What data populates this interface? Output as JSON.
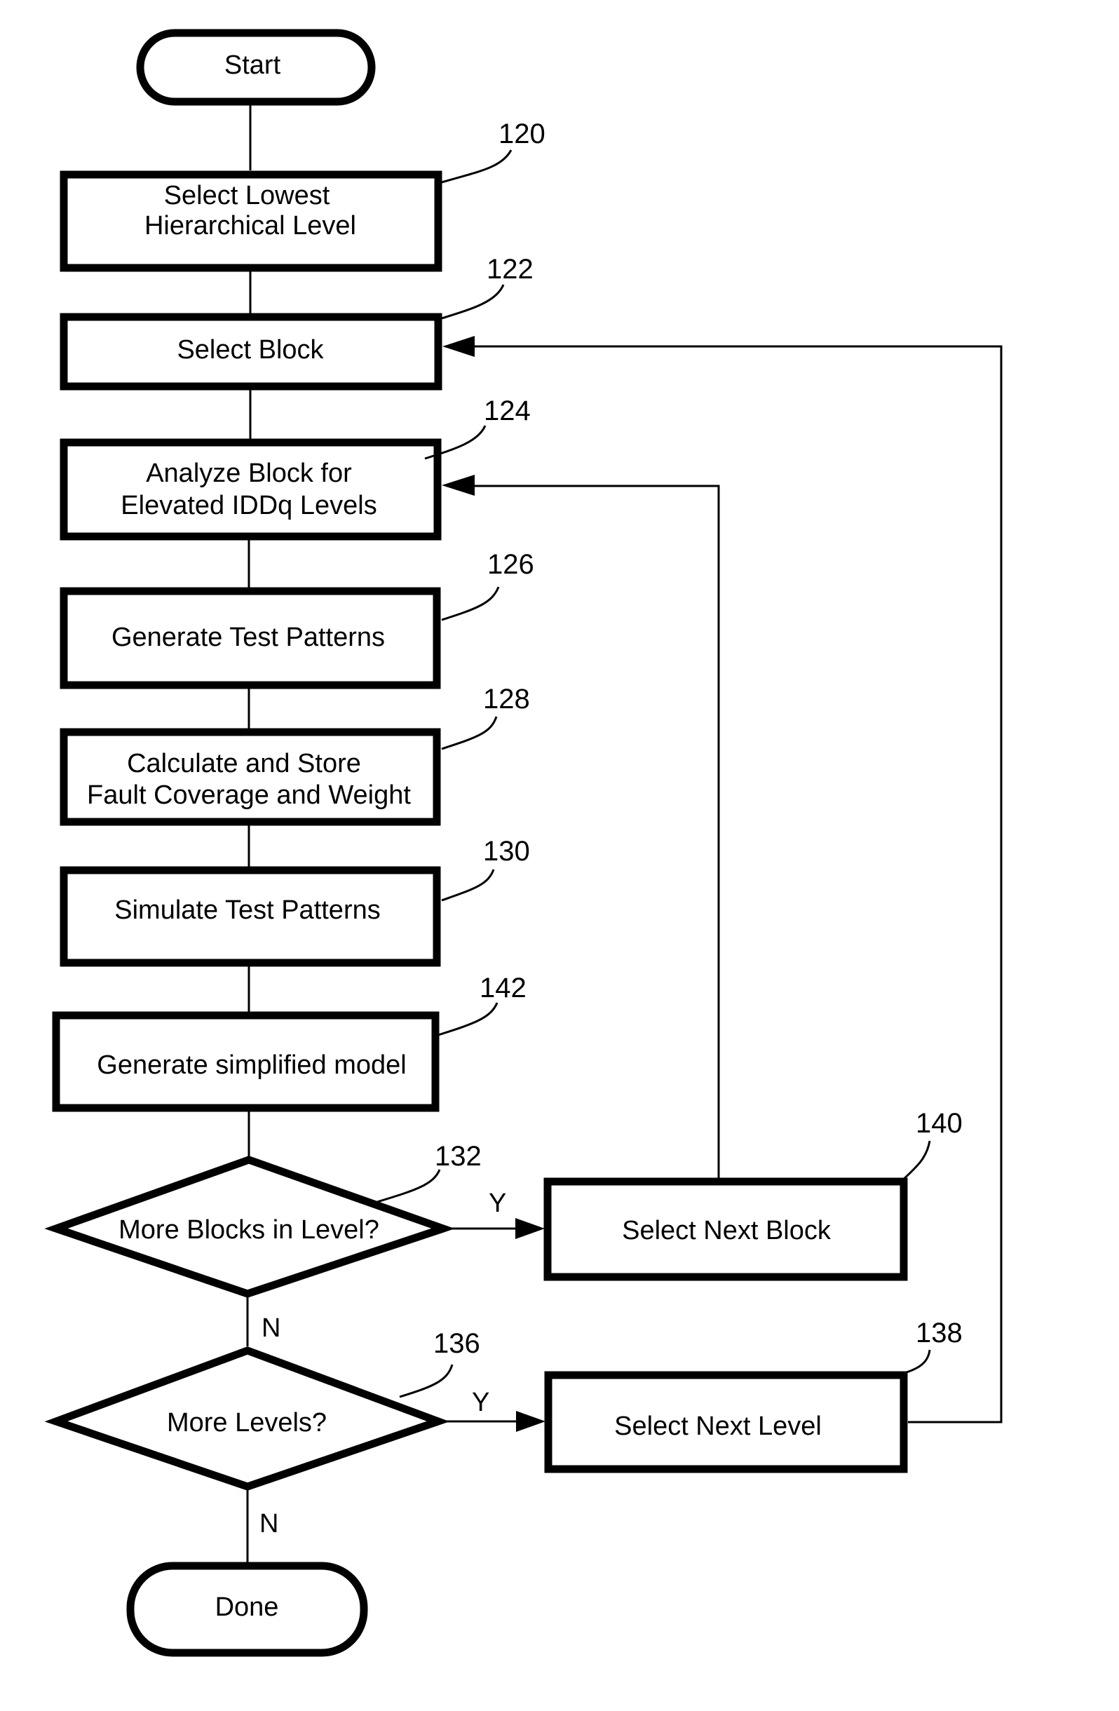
{
  "figure": {
    "kind": "flowchart",
    "colors": {
      "stroke": "#000000",
      "background": "#ffffff"
    }
  },
  "nodes": {
    "start": {
      "shape": "terminator",
      "lines": [
        "Start"
      ]
    },
    "n120": {
      "shape": "process",
      "ref": "120",
      "lines": [
        "Select Lowest",
        "Hierarchical Level"
      ]
    },
    "n122": {
      "shape": "process",
      "ref": "122",
      "lines": [
        "Select Block"
      ]
    },
    "n124": {
      "shape": "process",
      "ref": "124",
      "lines": [
        "Analyze Block for",
        "Elevated IDDq Levels"
      ]
    },
    "n126": {
      "shape": "process",
      "ref": "126",
      "lines": [
        "Generate Test Patterns"
      ]
    },
    "n128": {
      "shape": "process",
      "ref": "128",
      "lines": [
        "Calculate and Store",
        "Fault Coverage and Weight"
      ]
    },
    "n130": {
      "shape": "process",
      "ref": "130",
      "lines": [
        "Simulate Test Patterns"
      ]
    },
    "n142": {
      "shape": "process",
      "ref": "142",
      "lines": [
        "Generate simplified model"
      ]
    },
    "n132": {
      "shape": "decision",
      "ref": "132",
      "lines": [
        "More Blocks in Level?"
      ]
    },
    "n140": {
      "shape": "process",
      "ref": "140",
      "lines": [
        "Select Next Block"
      ]
    },
    "n136": {
      "shape": "decision",
      "ref": "136",
      "lines": [
        "More Levels?"
      ]
    },
    "n138": {
      "shape": "process",
      "ref": "138",
      "lines": [
        "Select Next Level"
      ]
    },
    "done": {
      "shape": "terminator",
      "lines": [
        "Done"
      ]
    }
  },
  "edges": [
    {
      "from": "start",
      "to": "n120",
      "label": ""
    },
    {
      "from": "n120",
      "to": "n122",
      "label": ""
    },
    {
      "from": "n122",
      "to": "n124",
      "label": ""
    },
    {
      "from": "n124",
      "to": "n126",
      "label": ""
    },
    {
      "from": "n126",
      "to": "n128",
      "label": ""
    },
    {
      "from": "n128",
      "to": "n130",
      "label": ""
    },
    {
      "from": "n130",
      "to": "n142",
      "label": ""
    },
    {
      "from": "n142",
      "to": "n132",
      "label": ""
    },
    {
      "from": "n132",
      "to": "n140",
      "label": "Y"
    },
    {
      "from": "n132",
      "to": "n136",
      "label": "N"
    },
    {
      "from": "n140",
      "to": "n124",
      "label": ""
    },
    {
      "from": "n136",
      "to": "n138",
      "label": "Y"
    },
    {
      "from": "n136",
      "to": "done",
      "label": "N"
    },
    {
      "from": "n138",
      "to": "n122",
      "label": ""
    }
  ],
  "branch_labels": {
    "blocks_yes": "Y",
    "blocks_no": "N",
    "levels_yes": "Y",
    "levels_no": "N"
  }
}
